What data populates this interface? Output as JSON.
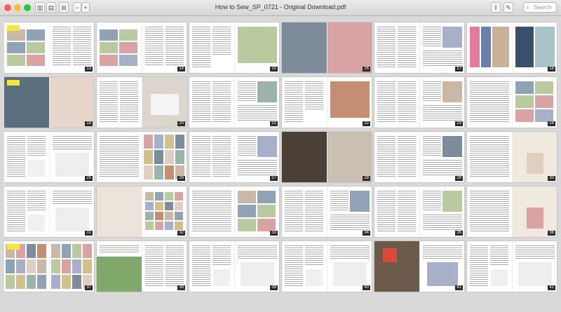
{
  "window": {
    "title": "How to Sew_SP_0721 - Original Download.pdf"
  },
  "toolbar": {
    "search_placeholder": "Search"
  },
  "thumbnails": [
    {
      "num": "13",
      "layout": "grid-left",
      "hl": true
    },
    {
      "num": "14",
      "layout": "grid-left"
    },
    {
      "num": "15",
      "layout": "photo-right"
    },
    {
      "num": "16",
      "layout": "photo-full"
    },
    {
      "num": "17",
      "layout": "text-photo"
    },
    {
      "num": "18",
      "layout": "fabric"
    },
    {
      "num": "19",
      "layout": "photo-split",
      "hl": true
    },
    {
      "num": "20",
      "layout": "machine"
    },
    {
      "num": "21",
      "layout": "text-photo"
    },
    {
      "num": "22",
      "layout": "photo-right"
    },
    {
      "num": "23",
      "layout": "text-photo"
    },
    {
      "num": "24",
      "layout": "grid-right"
    },
    {
      "num": "25",
      "layout": "text-diagram"
    },
    {
      "num": "26",
      "layout": "hangers"
    },
    {
      "num": "27",
      "layout": "text-photo"
    },
    {
      "num": "28",
      "layout": "photo-dark"
    },
    {
      "num": "29",
      "layout": "text-photo"
    },
    {
      "num": "30",
      "layout": "room"
    },
    {
      "num": "31",
      "layout": "text-diagram"
    },
    {
      "num": "32",
      "layout": "swatches"
    },
    {
      "num": "33",
      "layout": "grid-right"
    },
    {
      "num": "34",
      "layout": "text-photo"
    },
    {
      "num": "35",
      "layout": "text-photo"
    },
    {
      "num": "36",
      "layout": "room"
    },
    {
      "num": "37",
      "layout": "tops",
      "hl": true
    },
    {
      "num": "38",
      "layout": "outdoor"
    },
    {
      "num": "39",
      "layout": "text-diagram"
    },
    {
      "num": "40",
      "layout": "text-diagram"
    },
    {
      "num": "41",
      "layout": "workshop"
    },
    {
      "num": "42",
      "layout": "text-diagram"
    }
  ],
  "colors": {
    "bg": "#d9d9d9",
    "highlight": "#f5e83a",
    "label": "#2b2b2b"
  }
}
